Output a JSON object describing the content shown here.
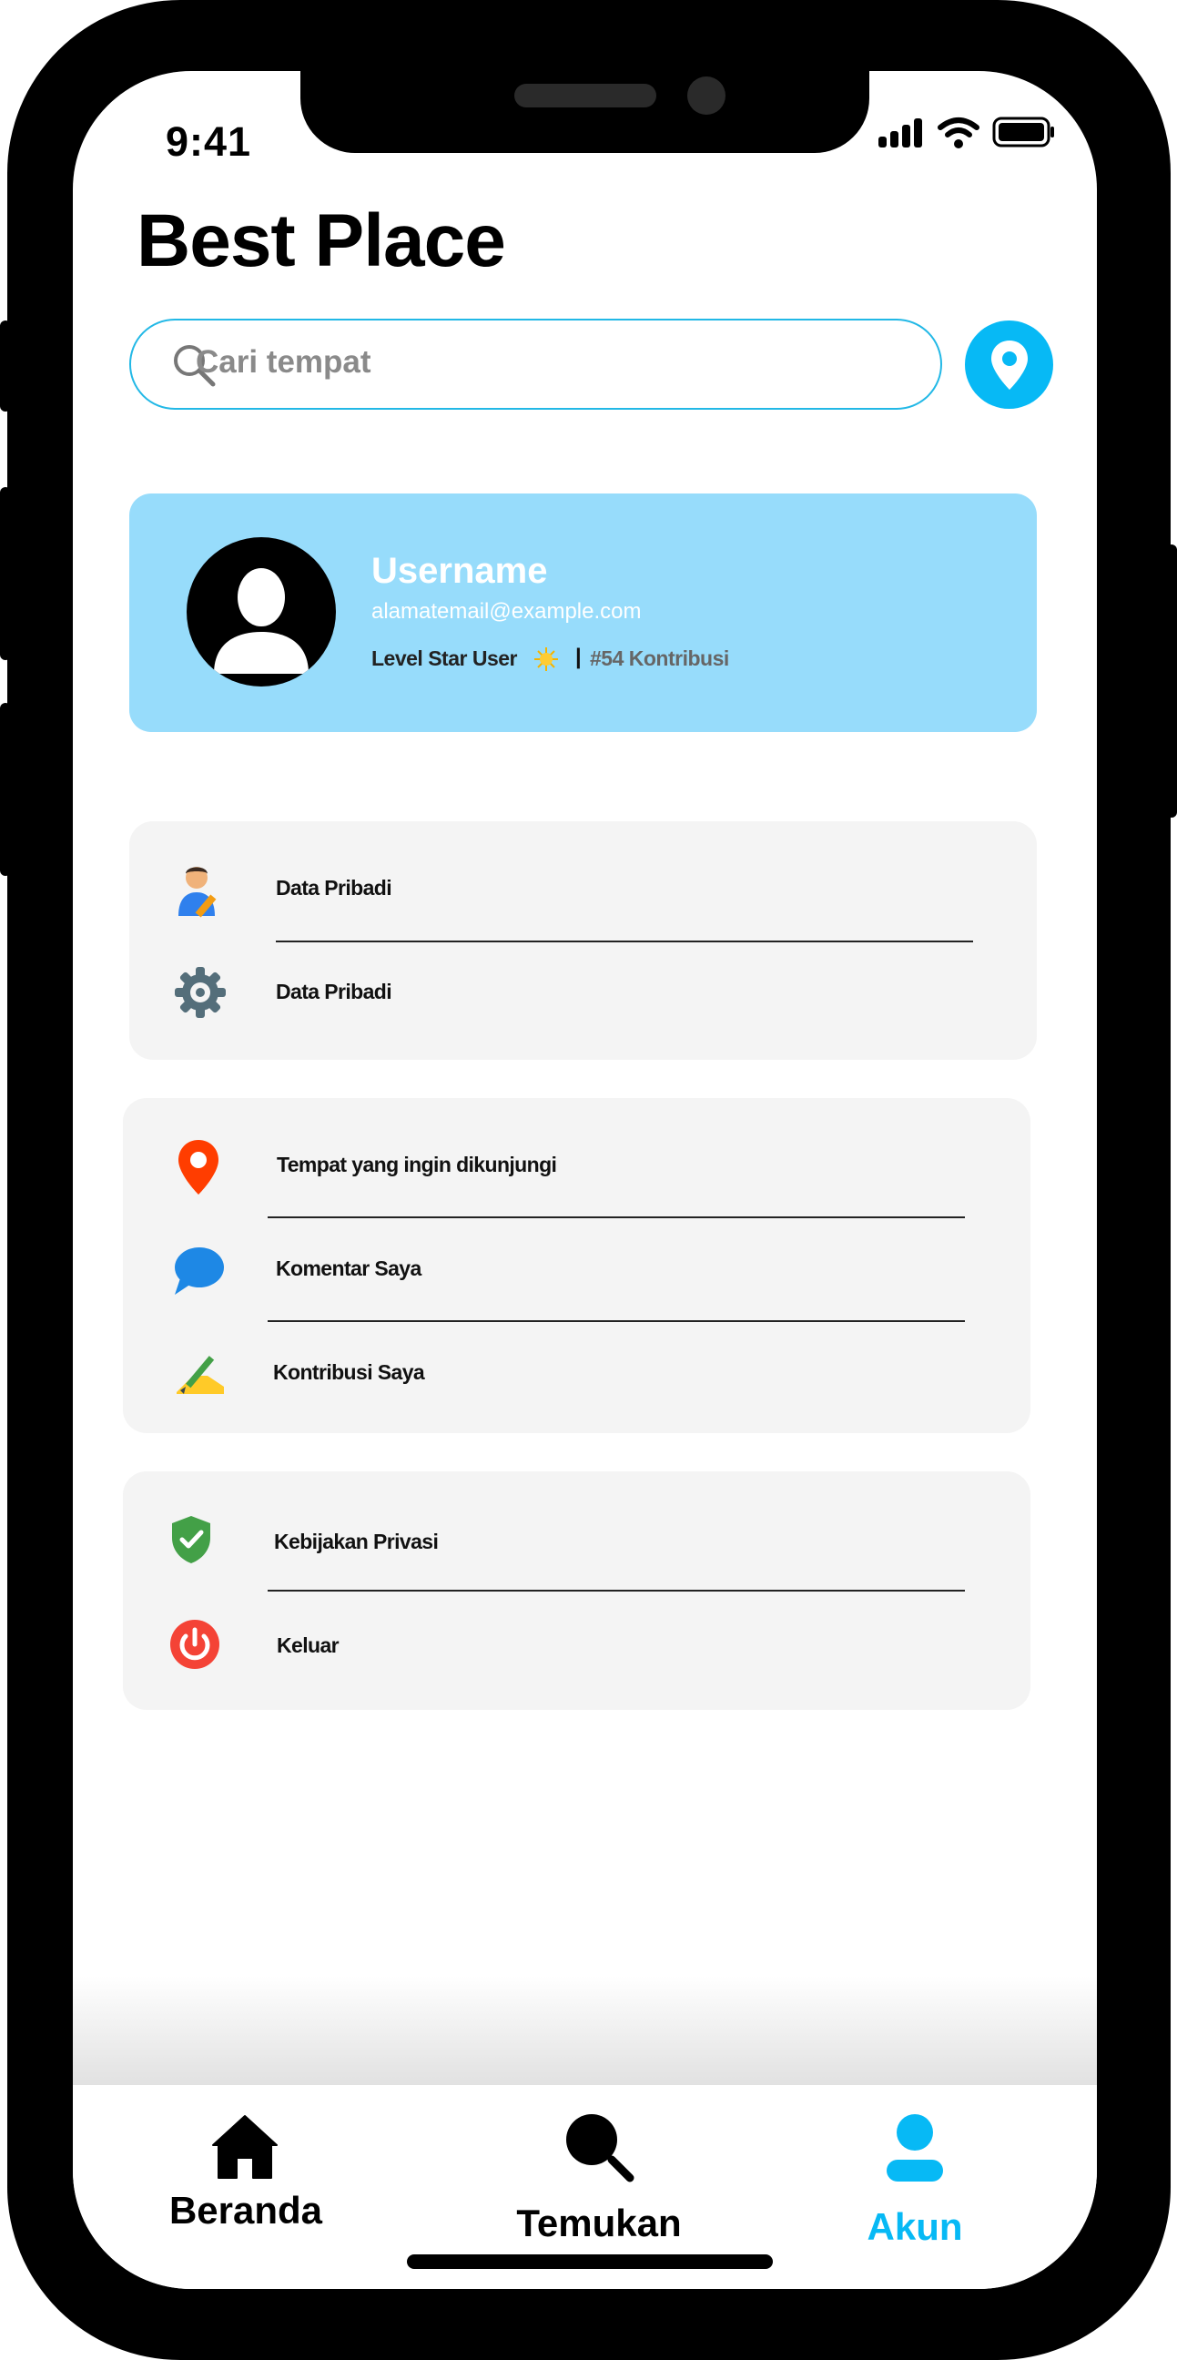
{
  "status_bar": {
    "time": "9:41"
  },
  "app": {
    "title": "Best Place"
  },
  "search": {
    "placeholder": "Cari tempat"
  },
  "profile": {
    "username": "Username",
    "email": "alamatemail@example.com",
    "level": "Level  Star User",
    "separator": "|",
    "contributions": "#54 Kontribusi"
  },
  "menu_groups": [
    {
      "items": [
        {
          "label": "Data Pribadi",
          "icon": "person-writing-icon"
        },
        {
          "label": "Data Pribadi",
          "icon": "gear-icon"
        }
      ]
    },
    {
      "items": [
        {
          "label": "Tempat yang ingin dikunjungi",
          "icon": "location-pin-icon"
        },
        {
          "label": "Komentar Saya",
          "icon": "chat-bubble-icon"
        },
        {
          "label": "Kontribusi Saya",
          "icon": "writing-hand-icon"
        }
      ]
    },
    {
      "items": [
        {
          "label": "Kebijakan Privasi",
          "icon": "shield-check-icon"
        },
        {
          "label": "Keluar",
          "icon": "power-icon"
        }
      ]
    }
  ],
  "tabs": [
    {
      "label": "Beranda",
      "icon": "home-icon",
      "active": false
    },
    {
      "label": "Temukan",
      "icon": "search-icon",
      "active": false
    },
    {
      "label": "Akun",
      "icon": "user-icon",
      "active": true
    }
  ],
  "colors": {
    "accent": "#07b9f5",
    "profile_card": "#97dcfb",
    "menu_card": "#f4f4f4"
  }
}
